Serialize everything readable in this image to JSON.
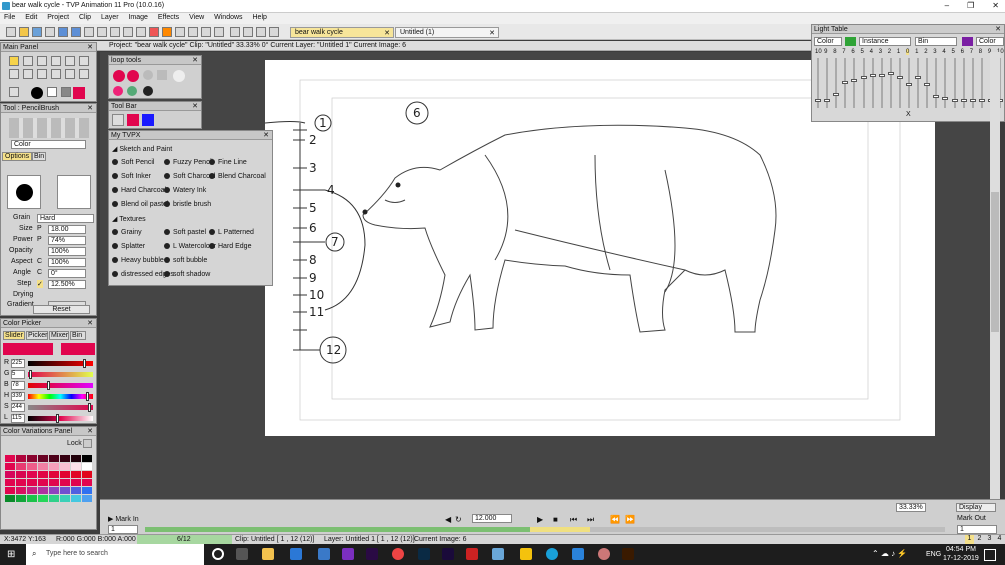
{
  "window": {
    "title": "bear walk cycle - TVP Animation 11 Pro (10.0.16)",
    "minimize": "–",
    "maximize": "❐",
    "close": "✕"
  },
  "menu": [
    "File",
    "Edit",
    "Project",
    "Clip",
    "Layer",
    "Image",
    "Effects",
    "View",
    "Windows",
    "Help"
  ],
  "tabs": [
    {
      "label": "bear walk cycle",
      "active": true
    },
    {
      "label": "Untitled (1)",
      "active": false
    }
  ],
  "info_text": "Project: \"bear walk cycle\"  Clip: \"Untitled\"  33.33%  0°  Current Layer: \"Untitled 1\"  Current Image: 6",
  "panels": {
    "main_panel": "Main Panel",
    "tool_panel": "Tool : PencilBrush",
    "tool_mode": "Color",
    "tool_tabs": [
      "Options",
      "Bin"
    ],
    "settings": [
      {
        "label": "Grain",
        "value": "Hard"
      },
      {
        "label": "Size",
        "flag": "P",
        "value": "18.00"
      },
      {
        "label": "Power",
        "flag": "P",
        "value": "74%"
      },
      {
        "label": "Opacity",
        "flag": "",
        "value": "100%"
      },
      {
        "label": "Aspect",
        "flag": "C",
        "value": "100%"
      },
      {
        "label": "Angle",
        "flag": "C",
        "value": "0°"
      },
      {
        "label": "Step",
        "flag": "✓",
        "value": "12.50%"
      },
      {
        "label": "Drying",
        "flag": "",
        "value": ""
      },
      {
        "label": "Gradient",
        "flag": "",
        "value": ""
      }
    ],
    "reset_label": "Reset",
    "color_picker": "Color Picker",
    "color_tabs": [
      "Slider",
      "Picker",
      "Mixer",
      "Bin"
    ],
    "color_values": [
      {
        "ch": "R",
        "v": "225",
        "p": 0.88
      },
      {
        "ch": "G",
        "v": "5",
        "p": 0.02
      },
      {
        "ch": "B",
        "v": "78",
        "p": 0.31
      },
      {
        "ch": "H",
        "v": "339",
        "p": 0.94
      },
      {
        "ch": "S",
        "v": "244",
        "p": 0.96
      },
      {
        "ch": "L",
        "v": "115",
        "p": 0.45
      }
    ],
    "color_variations": "Color Variations Panel",
    "lock_label": "Lock",
    "loop_tools": "loop tools",
    "tool_bar": "Tool Bar",
    "my_tvpx": "My TVPX"
  },
  "tvpx": {
    "section1": "Sketch and Paint",
    "brushes1": [
      [
        "Soft Pencil",
        "Fuzzy Pencil",
        "Fine Line"
      ],
      [
        "Soft Inker",
        "Soft Charcoal",
        "Blend Charcoal"
      ],
      [
        "Hard Charcoal",
        "Watery Ink",
        ""
      ],
      [
        "Blend oil pastel",
        "bristle brush",
        ""
      ]
    ],
    "section2": "Textures",
    "brushes2": [
      [
        "Grainy",
        "Soft pastel",
        "L Patterned"
      ],
      [
        "Splatter",
        "L Watercolour",
        "Hard Edge"
      ],
      [
        "Heavy bubble",
        "soft bubble",
        ""
      ],
      [
        "distressed edges",
        "soft shadow",
        ""
      ]
    ]
  },
  "light_table": {
    "title": "Light Table",
    "mode1": "Color",
    "mode2": "Instance",
    "mode3": "Bin",
    "mode4": "Color",
    "left_nums": [
      "10",
      "9",
      "8",
      "7",
      "6",
      "5",
      "4",
      "3",
      "2",
      "1",
      "0"
    ],
    "right_nums": [
      "1",
      "2",
      "3",
      "4",
      "5",
      "6",
      "7",
      "8",
      "9",
      "10"
    ],
    "active_value": "0",
    "close_label": "X",
    "colors": {
      "left": "#2fa336",
      "right": "#7a1fa3"
    }
  },
  "canvas": {
    "annotations": [
      "1",
      "2",
      "3",
      "4",
      "5",
      "6",
      "7",
      "8",
      "9",
      "10",
      "11",
      "12"
    ],
    "circled": [
      "6",
      "7",
      "12"
    ]
  },
  "timeline": {
    "mark_in": "Mark In",
    "mark_out": "Mark Out",
    "fps": "12.000",
    "frame_start": "1",
    "frame_end": "1",
    "zoom": "33.33%",
    "display": "Display",
    "pages": [
      "1",
      "2",
      "3",
      "4"
    ]
  },
  "status": {
    "coords": "X:3472 Y:163",
    "rgba": "R:000 G:000 B:000 A:000",
    "frame": "6/12",
    "clip": "Clip: Untitled [ 1 , 12  (12)]",
    "layer": "Layer: Untitled 1 [ 1 , 12  (12)]",
    "image": "Current Image: 6"
  },
  "taskbar": {
    "search_placeholder": "Type here to search",
    "time": "04:54 PM",
    "date": "17-12-2019",
    "lang": "ENG"
  },
  "colors": {
    "accent": "#e1054e"
  }
}
